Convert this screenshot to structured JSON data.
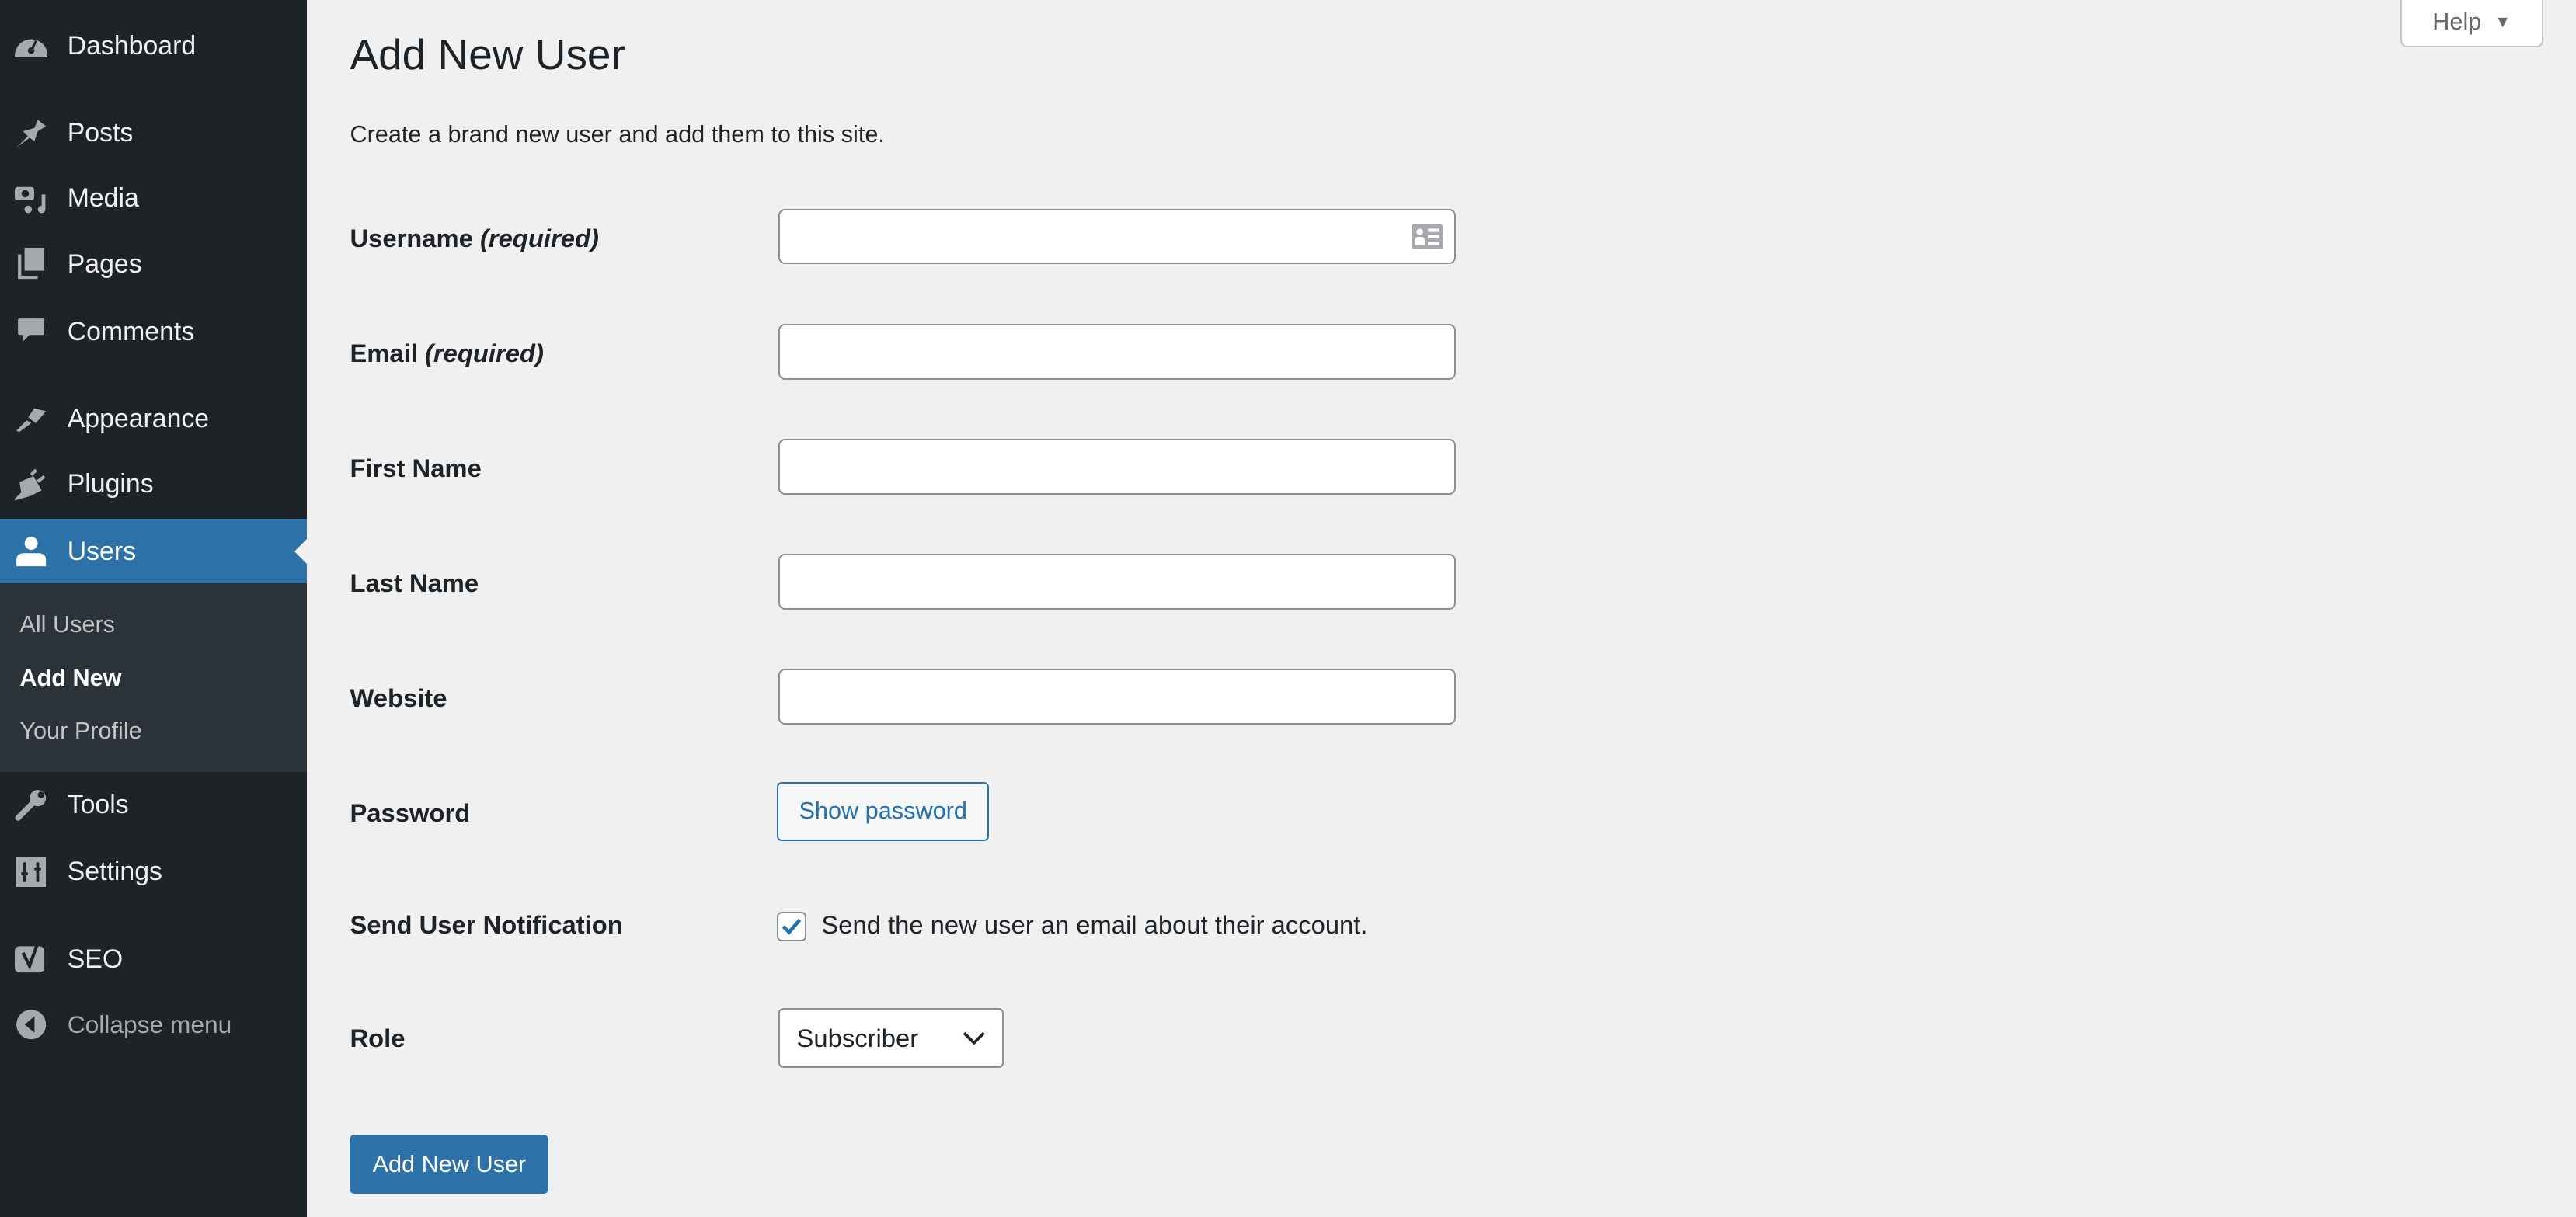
{
  "sidebar": {
    "items": [
      {
        "label": "Dashboard",
        "icon": "dashboard-icon"
      },
      {
        "label": "Posts",
        "icon": "pin-icon"
      },
      {
        "label": "Media",
        "icon": "media-icon"
      },
      {
        "label": "Pages",
        "icon": "pages-icon"
      },
      {
        "label": "Comments",
        "icon": "comment-icon"
      },
      {
        "label": "Appearance",
        "icon": "paintbrush-icon"
      },
      {
        "label": "Plugins",
        "icon": "plugin-icon"
      },
      {
        "label": "Users",
        "icon": "user-icon",
        "active": true
      },
      {
        "label": "Tools",
        "icon": "wrench-icon"
      },
      {
        "label": "Settings",
        "icon": "settings-icon"
      },
      {
        "label": "SEO",
        "icon": "yoast-icon"
      },
      {
        "label": "Collapse menu",
        "icon": "collapse-icon"
      }
    ],
    "submenu": [
      {
        "label": "All Users"
      },
      {
        "label": "Add New",
        "current": true
      },
      {
        "label": "Your Profile"
      }
    ]
  },
  "help": {
    "label": "Help"
  },
  "page": {
    "title": "Add New User",
    "description": "Create a brand new user and add them to this site."
  },
  "form": {
    "username": {
      "label": "Username",
      "required": "(required)",
      "value": ""
    },
    "email": {
      "label": "Email",
      "required": "(required)",
      "value": ""
    },
    "first_name": {
      "label": "First Name",
      "value": ""
    },
    "last_name": {
      "label": "Last Name",
      "value": ""
    },
    "website": {
      "label": "Website",
      "value": ""
    },
    "password": {
      "label": "Password",
      "button": "Show password"
    },
    "notification": {
      "label": "Send User Notification",
      "checkbox": "Send the new user an email about their account.",
      "checked": true
    },
    "role": {
      "label": "Role",
      "value": "Subscriber"
    },
    "submit": "Add New User"
  },
  "colors": {
    "sidebar": "#1d2327",
    "accent": "#2c72a8",
    "background": "#f0f0f1"
  }
}
